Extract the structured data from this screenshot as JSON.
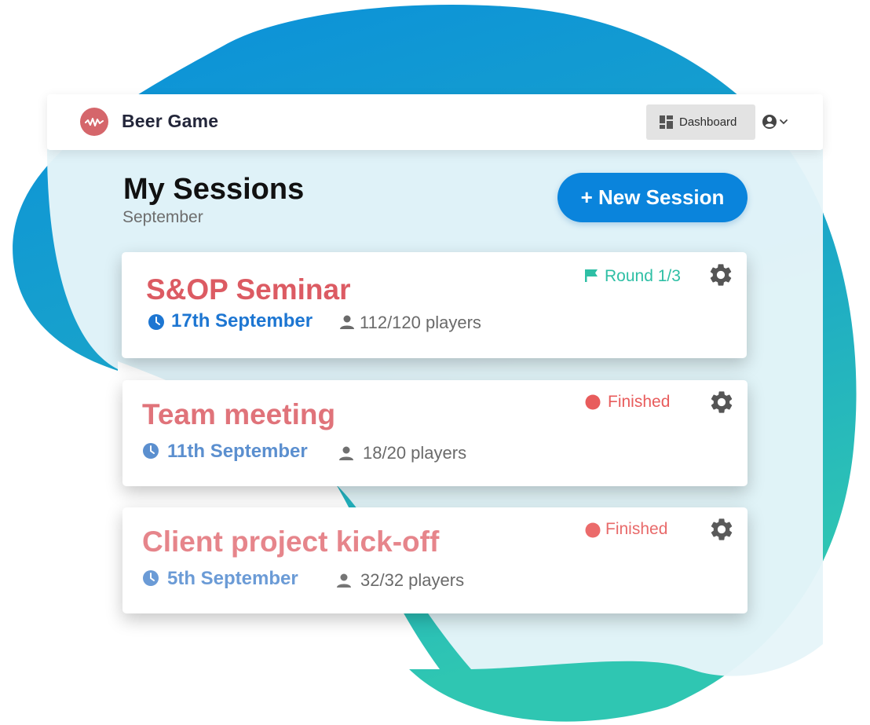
{
  "app": {
    "title": "Beer Game"
  },
  "header": {
    "dashboard_label": "Dashboard"
  },
  "page": {
    "title": "My Sessions",
    "subtitle": "September",
    "new_session_label": "+ New Session"
  },
  "colors": {
    "accent": "#0a84dc",
    "title_red": "#dc5b63",
    "date_blue": "#1d76d2",
    "status_green": "#2ebfa5",
    "status_red": "#e85c5c"
  },
  "sessions": [
    {
      "title": "S&OP Seminar",
      "date": "17th September",
      "players": "112/120 players",
      "status": "Round 1/3",
      "status_icon": "flag-icon"
    },
    {
      "title": "Team meeting",
      "date": "11th September",
      "players": "18/20 players",
      "status": "Finished",
      "status_icon": "red-dot-icon"
    },
    {
      "title": "Client project kick-off",
      "date": "5th September",
      "players": "32/32 players",
      "status": "Finished",
      "status_icon": "red-dot-icon"
    }
  ]
}
